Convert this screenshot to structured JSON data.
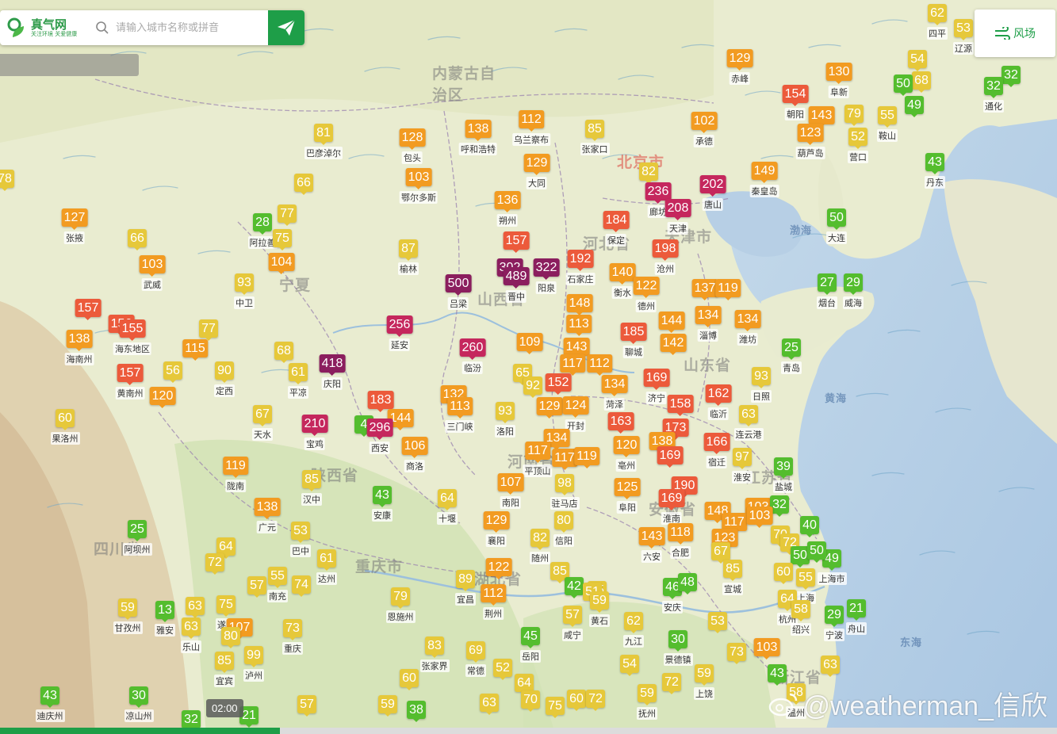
{
  "header": {
    "logo_name": "真气网",
    "logo_slogan": "关注环境 关爱健康",
    "search_placeholder": "请输入城市名称或拼音",
    "wind_label": "风场",
    "time_label": "02:00",
    "watermark": "@weatherman_信欣",
    "timeline_progress": 0.265
  },
  "colors": {
    "good": "#54bd2e",
    "moderate": "#e6c83a",
    "usg": "#f29b21",
    "unhealthy": "#ec5a3b",
    "very_unhealthy": "#c5275d",
    "hazardous": "#8b1e5e",
    "brand": "#1e9e48"
  },
  "map": {
    "provinces": [
      "内蒙古自治区",
      "北京市",
      "河北省",
      "天津市",
      "山西省",
      "陕西省",
      "山东省",
      "河南省",
      "安徽省",
      "四川省",
      "重庆市",
      "湖北省",
      "江苏省",
      "浙江省",
      "宁夏"
    ],
    "seas": [
      "渤海",
      "黄海",
      "东海"
    ],
    "markers": [
      {
        "v": "62",
        "n": "四平"
      },
      {
        "v": "53",
        "n": "辽源"
      },
      {
        "v": "54",
        "n": ""
      },
      {
        "v": "68",
        "n": ""
      },
      {
        "v": "50",
        "n": ""
      },
      {
        "v": "49",
        "n": ""
      },
      {
        "v": "32",
        "n": ""
      },
      {
        "v": "32",
        "n": "通化"
      },
      {
        "v": "129",
        "n": "赤峰"
      },
      {
        "v": "130",
        "n": "阜新"
      },
      {
        "v": "154",
        "n": "朝阳"
      },
      {
        "v": "143",
        "n": ""
      },
      {
        "v": "79",
        "n": ""
      },
      {
        "v": "55",
        "n": "鞍山"
      },
      {
        "v": "123",
        "n": "葫芦岛"
      },
      {
        "v": "52",
        "n": "营口"
      },
      {
        "v": "43",
        "n": "丹东"
      },
      {
        "v": "81",
        "n": "巴彦淖尔"
      },
      {
        "v": "128",
        "n": "包头"
      },
      {
        "v": "138",
        "n": "呼和浩特"
      },
      {
        "v": "112",
        "n": "乌兰察布"
      },
      {
        "v": "85",
        "n": "张家口"
      },
      {
        "v": "102",
        "n": "承德"
      },
      {
        "v": "149",
        "n": "秦皇岛"
      },
      {
        "v": "129",
        "n": "大同"
      },
      {
        "v": "103",
        "n": "鄂尔多斯"
      },
      {
        "v": "82",
        "n": ""
      },
      {
        "v": "236",
        "n": "廊坊"
      },
      {
        "v": "202",
        "n": "唐山"
      },
      {
        "v": "208",
        "n": "天津"
      },
      {
        "v": "50",
        "n": "大连"
      },
      {
        "v": "66",
        "n": ""
      },
      {
        "v": "127",
        "n": "张掖"
      },
      {
        "v": "28",
        "n": "阿拉善"
      },
      {
        "v": "77",
        "n": ""
      },
      {
        "v": "75",
        "n": ""
      },
      {
        "v": "136",
        "n": "朔州"
      },
      {
        "v": "184",
        "n": "保定"
      },
      {
        "v": "157",
        "n": ""
      },
      {
        "v": "66",
        "n": ""
      },
      {
        "v": "103",
        "n": "武威"
      },
      {
        "v": "104",
        "n": ""
      },
      {
        "v": "87",
        "n": "榆林"
      },
      {
        "v": "192",
        "n": "石家庄"
      },
      {
        "v": "198",
        "n": "沧州"
      },
      {
        "v": "302",
        "n": ""
      },
      {
        "v": "489",
        "n": "晋中"
      },
      {
        "v": "322",
        "n": "阳泉"
      },
      {
        "v": "140",
        "n": "衡水"
      },
      {
        "v": "500",
        "n": "吕梁"
      },
      {
        "v": "93",
        "n": "中卫"
      },
      {
        "v": "122",
        "n": "德州"
      },
      {
        "v": "137",
        "n": ""
      },
      {
        "v": "119",
        "n": ""
      },
      {
        "v": "27",
        "n": "烟台"
      },
      {
        "v": "29",
        "n": "威海"
      },
      {
        "v": "157",
        "n": ""
      },
      {
        "v": "148",
        "n": ""
      },
      {
        "v": "156",
        "n": ""
      },
      {
        "v": "155",
        "n": "海东地区"
      },
      {
        "v": "77",
        "n": ""
      },
      {
        "v": "256",
        "n": "延安"
      },
      {
        "v": "113",
        "n": ""
      },
      {
        "v": "185",
        "n": "聊城"
      },
      {
        "v": "144",
        "n": ""
      },
      {
        "v": "134",
        "n": "淄博"
      },
      {
        "v": "134",
        "n": "潍坊"
      },
      {
        "v": "138",
        "n": "海南州"
      },
      {
        "v": "115",
        "n": ""
      },
      {
        "v": "68",
        "n": ""
      },
      {
        "v": "260",
        "n": "临汾"
      },
      {
        "v": "109",
        "n": ""
      },
      {
        "v": "143",
        "n": ""
      },
      {
        "v": "142",
        "n": ""
      },
      {
        "v": "25",
        "n": "青岛"
      },
      {
        "v": "418",
        "n": "庆阳"
      },
      {
        "v": "56",
        "n": ""
      },
      {
        "v": "90",
        "n": "定西"
      },
      {
        "v": "61",
        "n": "平凉"
      },
      {
        "v": "117",
        "n": ""
      },
      {
        "v": "112",
        "n": ""
      },
      {
        "v": "157",
        "n": "黄南州"
      },
      {
        "v": "120",
        "n": ""
      },
      {
        "v": "65",
        "n": ""
      },
      {
        "v": "169",
        "n": "济宁"
      },
      {
        "v": "93",
        "n": "日照"
      },
      {
        "v": "92",
        "n": ""
      },
      {
        "v": "152",
        "n": ""
      },
      {
        "v": "134",
        "n": "菏泽"
      },
      {
        "v": "183",
        "n": ""
      },
      {
        "v": "132",
        "n": ""
      },
      {
        "v": "162",
        "n": "临沂"
      },
      {
        "v": "113",
        "n": "三门峡"
      },
      {
        "v": "144",
        "n": ""
      },
      {
        "v": "93",
        "n": "洛阳"
      },
      {
        "v": "129",
        "n": ""
      },
      {
        "v": "124",
        "n": "开封"
      },
      {
        "v": "158",
        "n": ""
      },
      {
        "v": "60",
        "n": "果洛州"
      },
      {
        "v": "67",
        "n": "天水"
      },
      {
        "v": "210",
        "n": "宝鸡"
      },
      {
        "v": "4",
        "n": ""
      },
      {
        "v": "296",
        "n": "西安"
      },
      {
        "v": "163",
        "n": ""
      },
      {
        "v": "63",
        "n": "连云港"
      },
      {
        "v": "173",
        "n": ""
      },
      {
        "v": "134",
        "n": ""
      },
      {
        "v": "106",
        "n": "商洛"
      },
      {
        "v": "138",
        "n": ""
      },
      {
        "v": "166",
        "n": "宿迁"
      },
      {
        "v": "117",
        "n": "平顶山"
      },
      {
        "v": "117",
        "n": ""
      },
      {
        "v": "119",
        "n": ""
      },
      {
        "v": "120",
        "n": "亳州"
      },
      {
        "v": "97",
        "n": "淮安"
      },
      {
        "v": "169",
        "n": ""
      },
      {
        "v": "119",
        "n": "陇南"
      },
      {
        "v": "39",
        "n": "盐城"
      },
      {
        "v": "85",
        "n": "汉中"
      },
      {
        "v": "107",
        "n": "南阳"
      },
      {
        "v": "98",
        "n": "驻马店"
      },
      {
        "v": "190",
        "n": ""
      },
      {
        "v": "125",
        "n": "阜阳"
      },
      {
        "v": "138",
        "n": "广元"
      },
      {
        "v": "43",
        "n": "安康"
      },
      {
        "v": "64",
        "n": "十堰"
      },
      {
        "v": "169",
        "n": "淮南"
      },
      {
        "v": "148",
        "n": ""
      },
      {
        "v": "103",
        "n": ""
      },
      {
        "v": "32",
        "n": ""
      },
      {
        "v": "25",
        "n": "阿坝州"
      },
      {
        "v": "53",
        "n": "巴中"
      },
      {
        "v": "129",
        "n": "襄阳"
      },
      {
        "v": "80",
        "n": "信阳"
      },
      {
        "v": "117",
        "n": ""
      },
      {
        "v": "103",
        "n": ""
      },
      {
        "v": "40",
        "n": ""
      },
      {
        "v": "64",
        "n": ""
      },
      {
        "v": "61",
        "n": "达州"
      },
      {
        "v": "82",
        "n": "随州"
      },
      {
        "v": "143",
        "n": "六安"
      },
      {
        "v": "118",
        "n": "合肥"
      },
      {
        "v": "123",
        "n": ""
      },
      {
        "v": "70",
        "n": ""
      },
      {
        "v": "72",
        "n": ""
      },
      {
        "v": "72",
        "n": ""
      },
      {
        "v": "122",
        "n": ""
      },
      {
        "v": "67",
        "n": ""
      },
      {
        "v": "50",
        "n": ""
      },
      {
        "v": "49",
        "n": "上海市"
      },
      {
        "v": "50",
        "n": ""
      },
      {
        "v": "57",
        "n": ""
      },
      {
        "v": "55",
        "n": "南充"
      },
      {
        "v": "74",
        "n": ""
      },
      {
        "v": "89",
        "n": "宜昌"
      },
      {
        "v": "112",
        "n": "荆州"
      },
      {
        "v": "85",
        "n": ""
      },
      {
        "v": "42",
        "n": ""
      },
      {
        "v": "55",
        "n": ""
      },
      {
        "v": "85",
        "n": "宣城"
      },
      {
        "v": "60",
        "n": ""
      },
      {
        "v": "55",
        "n": "上海"
      },
      {
        "v": "79",
        "n": "恩施州"
      },
      {
        "v": "51",
        "n": ""
      },
      {
        "v": "59",
        "n": "黄石"
      },
      {
        "v": "46",
        "n": "安庆"
      },
      {
        "v": "48",
        "n": ""
      },
      {
        "v": "64",
        "n": "杭州"
      },
      {
        "v": "58",
        "n": "绍兴"
      },
      {
        "v": "59",
        "n": "甘孜州"
      },
      {
        "v": "13",
        "n": "雅安"
      },
      {
        "v": "63",
        "n": ""
      },
      {
        "v": "75",
        "n": "遂宁"
      },
      {
        "v": "57",
        "n": "咸宁"
      },
      {
        "v": "29",
        "n": "宁波"
      },
      {
        "v": "21",
        "n": "舟山"
      },
      {
        "v": "63",
        "n": "乐山"
      },
      {
        "v": "107",
        "n": ""
      },
      {
        "v": "73",
        "n": "重庆"
      },
      {
        "v": "62",
        "n": "九江"
      },
      {
        "v": "53",
        "n": ""
      },
      {
        "v": "80",
        "n": ""
      },
      {
        "v": "45",
        "n": "岳阳"
      },
      {
        "v": "30",
        "n": "景德镇"
      },
      {
        "v": "85",
        "n": "宜宾"
      },
      {
        "v": "99",
        "n": "泸州"
      },
      {
        "v": "83",
        "n": "张家界"
      },
      {
        "v": "69",
        "n": "常德"
      },
      {
        "v": "73",
        "n": ""
      },
      {
        "v": "103",
        "n": ""
      },
      {
        "v": "52",
        "n": ""
      },
      {
        "v": "54",
        "n": ""
      },
      {
        "v": "63",
        "n": ""
      },
      {
        "v": "64",
        "n": ""
      },
      {
        "v": "72",
        "n": ""
      },
      {
        "v": "59",
        "n": "上饶"
      },
      {
        "v": "43",
        "n": ""
      },
      {
        "v": "60",
        "n": ""
      },
      {
        "v": "43",
        "n": "迪庆州"
      },
      {
        "v": "30",
        "n": "凉山州"
      },
      {
        "v": "57",
        "n": ""
      },
      {
        "v": "59",
        "n": ""
      },
      {
        "v": "38",
        "n": ""
      },
      {
        "v": "70",
        "n": ""
      },
      {
        "v": "60",
        "n": ""
      },
      {
        "v": "72",
        "n": ""
      },
      {
        "v": "58",
        "n": "温州"
      },
      {
        "v": "63",
        "n": ""
      },
      {
        "v": "75",
        "n": ""
      },
      {
        "v": "59",
        "n": "抚州"
      },
      {
        "v": "32",
        "n": ""
      },
      {
        "v": "21",
        "n": ""
      },
      {
        "v": "78",
        "n": ""
      }
    ]
  }
}
